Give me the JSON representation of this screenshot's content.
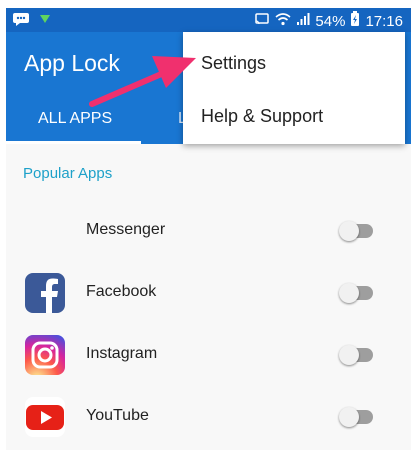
{
  "status_bar": {
    "battery_percent": "54%",
    "time": "17:16",
    "icons": [
      "message-icon",
      "download-icon",
      "cast-icon",
      "wifi-icon",
      "signal-icon",
      "battery-icon"
    ]
  },
  "app_bar": {
    "title": "App Lock",
    "tabs": [
      {
        "label": "ALL APPS",
        "selected": true
      },
      {
        "label": "L"
      }
    ],
    "color": "#1976d2"
  },
  "menu": {
    "items": [
      {
        "label": "Settings"
      },
      {
        "label": "Help & Support"
      }
    ]
  },
  "section": {
    "title": "Popular Apps",
    "color": "#1ea1c9"
  },
  "apps": [
    {
      "name": "Messenger",
      "locked": false,
      "icon": "none"
    },
    {
      "name": "Facebook",
      "locked": false,
      "icon": "facebook-icon"
    },
    {
      "name": "Instagram",
      "locked": false,
      "icon": "instagram-icon"
    },
    {
      "name": "YouTube",
      "locked": false,
      "icon": "youtube-icon"
    }
  ],
  "annotation": {
    "arrow_color": "#f0306e"
  }
}
